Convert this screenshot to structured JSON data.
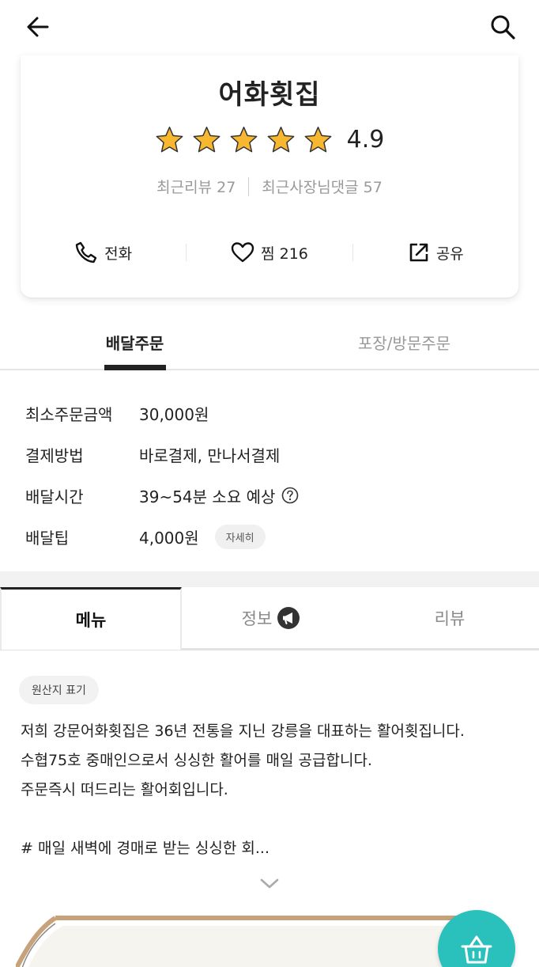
{
  "header": {
    "back_icon": "arrow-left-icon",
    "search_icon": "search-icon"
  },
  "store": {
    "name": "어화횟집",
    "rating": 4.9,
    "rating_text": "4.9",
    "stars": 5,
    "star_color": "#f7b731",
    "recent_reviews": "최근리뷰 27",
    "recent_owner_replies": "최근사장님댓글 57",
    "actions": {
      "call_label": "전화",
      "like_label": "찜 216",
      "share_label": "공유"
    }
  },
  "order_tabs": {
    "delivery": "배달주문",
    "pickup": "포장/방문주문",
    "active": "delivery"
  },
  "delivery_info": {
    "rows": [
      {
        "label": "최소주문금액",
        "value": "30,000원"
      },
      {
        "label": "결제방법",
        "value": "바로결제, 만나서결제"
      },
      {
        "label": "배달시간",
        "value": "39~54분 소요 예상"
      },
      {
        "label": "배달팁",
        "value": "4,000원"
      }
    ],
    "detail_label": "자세히"
  },
  "menu_tabs": {
    "menu": "메뉴",
    "info": "정보",
    "review": "리뷰",
    "active": "menu"
  },
  "content": {
    "origin_label": "원산지 표기",
    "desc_lines": [
      "저희 강문어화횟집은 36년 전통을 지닌 강릉을 대표하는 활어횟집니다.",
      "수협75호 중매인으로서 싱싱한 활어를 매일 공급합니다.",
      "주문즉시 떠드리는 활어회입니다.",
      "# 매일 새벽에 경매로 받는 싱싱한 회..."
    ]
  },
  "colors": {
    "accent": "#2ac1bc",
    "text": "#222222",
    "muted": "#999999"
  }
}
